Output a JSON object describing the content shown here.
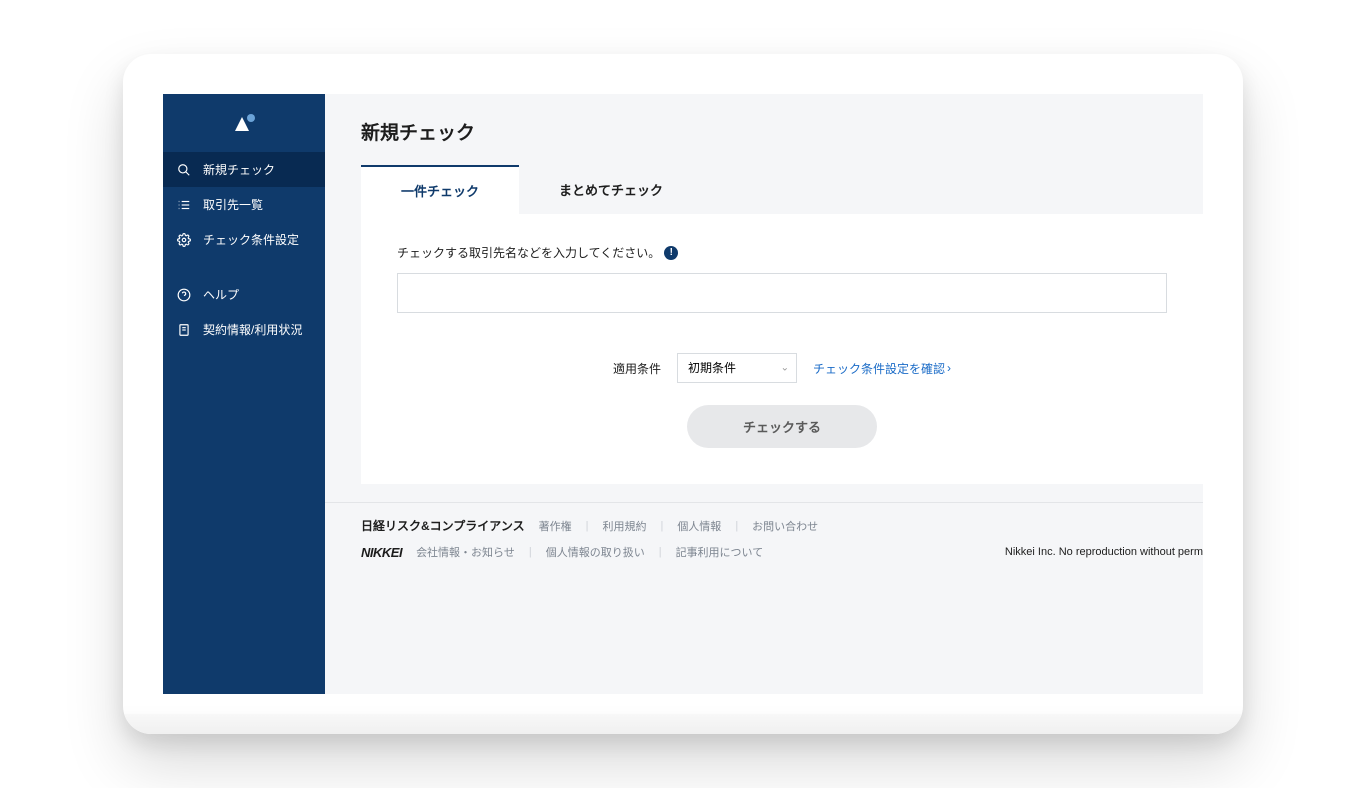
{
  "sidebar": {
    "items": [
      {
        "label": "新規チェック",
        "icon": "search"
      },
      {
        "label": "取引先一覧",
        "icon": "list"
      },
      {
        "label": "チェック条件設定",
        "icon": "gear"
      },
      {
        "label": "ヘルプ",
        "icon": "help"
      },
      {
        "label": "契約情報/利用状況",
        "icon": "document"
      }
    ]
  },
  "page": {
    "title": "新規チェック",
    "tabs": [
      {
        "label": "一件チェック"
      },
      {
        "label": "まとめてチェック"
      }
    ]
  },
  "form": {
    "input_label": "チェックする取引先名などを入力してください。",
    "info_char": "!",
    "conditions_label": "適用条件",
    "select_value": "初期条件",
    "confirm_link": "チェック条件設定を確認",
    "submit_label": "チェックする"
  },
  "footer": {
    "service_name": "日経リスク&コンプライアンス",
    "row1_links": [
      "著作権",
      "利用規約",
      "個人情報",
      "お問い合わせ"
    ],
    "nikkei_logo": "NIKKEI",
    "row2_links": [
      "会社情報・お知らせ",
      "個人情報の取り扱い",
      "記事利用について"
    ],
    "copyright": "Nikkei Inc. No reproduction without perm"
  }
}
